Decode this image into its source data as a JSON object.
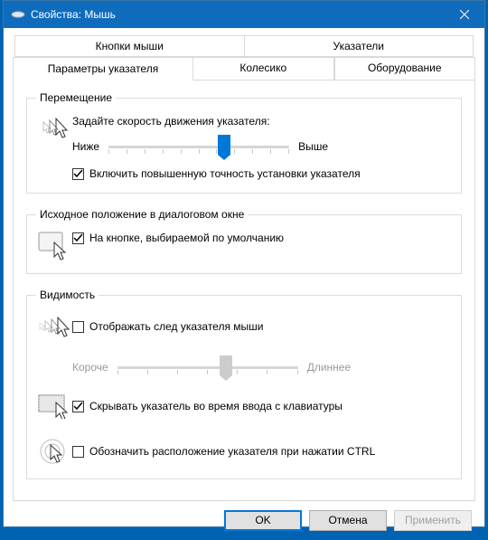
{
  "window": {
    "title": "Свойства: Мышь"
  },
  "tabs": {
    "row1": [
      "Кнопки мыши",
      "Указатели"
    ],
    "row2": [
      "Параметры указателя",
      "Колесико",
      "Оборудование"
    ],
    "active_index": 0
  },
  "groups": {
    "motion": {
      "legend": "Перемещение",
      "speed_label": "Задайте скорость движения указателя:",
      "slider_min": "Ниже",
      "slider_max": "Выше",
      "slider_value_pct": 64,
      "enhance_precision": "Включить повышенную точность установки указателя",
      "enhance_precision_checked": true
    },
    "snap": {
      "legend": "Исходное положение в диалоговом окне",
      "snap_label": "На кнопке, выбираемой по умолчанию",
      "snap_checked": true
    },
    "visibility": {
      "legend": "Видимость",
      "trails_label": "Отображать след указателя мыши",
      "trails_checked": false,
      "trail_min": "Короче",
      "trail_max": "Длиннее",
      "trail_value_pct": 60,
      "hide_typing_label": "Скрывать указатель во время ввода с клавиатуры",
      "hide_typing_checked": true,
      "ctrl_locate_label": "Обозначить расположение указателя при нажатии CTRL",
      "ctrl_locate_checked": false
    }
  },
  "buttons": {
    "ok": "OK",
    "cancel": "Отмена",
    "apply": "Применить"
  }
}
